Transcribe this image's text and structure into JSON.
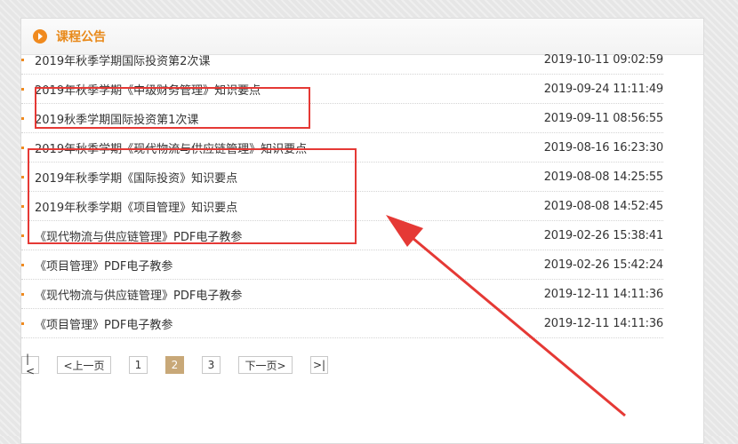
{
  "header": {
    "title": "课程公告"
  },
  "announcements": [
    {
      "title": "2019年秋季学期国际投资第2次课",
      "date": "2019-10-11 09:02:59"
    },
    {
      "title": "2019年秋季学期《中级财务管理》知识要点",
      "date": "2019-09-24 11:11:49"
    },
    {
      "title": "2019秋季学期国际投资第1次课",
      "date": "2019-09-11 08:56:55"
    },
    {
      "title": "2019年秋季学期《现代物流与供应链管理》知识要点",
      "date": "2019-08-16 16:23:30"
    },
    {
      "title": "2019年秋季学期《国际投资》知识要点",
      "date": "2019-08-08 14:25:55"
    },
    {
      "title": "2019年秋季学期《项目管理》知识要点",
      "date": "2019-08-08 14:52:45"
    },
    {
      "title": "《现代物流与供应链管理》PDF电子教参",
      "date": "2019-02-26 15:38:41"
    },
    {
      "title": "《项目管理》PDF电子教参",
      "date": "2019-02-26 15:42:24"
    },
    {
      "title": "《现代物流与供应链管理》PDF电子教参",
      "date": "2019-12-11 14:11:36"
    },
    {
      "title": "《项目管理》PDF电子教参",
      "date": "2019-12-11 14:11:36"
    }
  ],
  "pagination": {
    "first": "|<",
    "prev": "<上一页",
    "pages": [
      "1",
      "2",
      "3"
    ],
    "current": "2",
    "next": "下一页>",
    "last": ">|"
  },
  "colors": {
    "accent": "#e8891a",
    "annotation": "#e53935",
    "current_page": "#c8a878"
  }
}
